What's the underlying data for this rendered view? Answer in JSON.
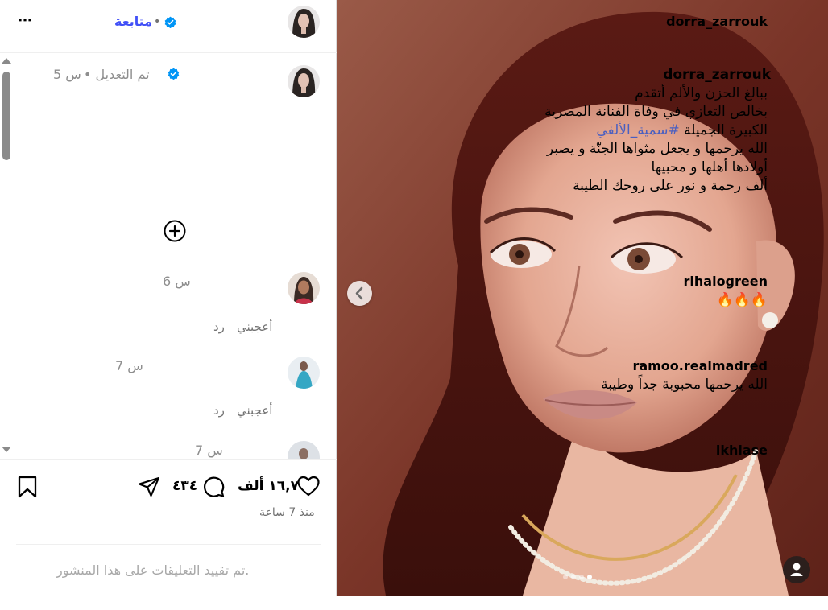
{
  "post": {
    "username": "dorra_zarrouk",
    "follow_label": "متابعة",
    "separator": "•",
    "more_label": "⋯"
  },
  "caption": {
    "username": "dorra_zarrouk",
    "edited_label": "• تم التعديل",
    "time": "5 س",
    "lines": [
      "ببالغ الحزن والألم أتقدم",
      "بخالص التعازي في وفاة الفنانة المصرية",
      "الكبيرة الجميلة",
      "الله يرحمها و يجعل مثواها الجنّة  و يصبر",
      "أولادها أهلها و محبيها",
      "ألف رحمة و نور على روحك الطيبة"
    ],
    "hashtag": "#سمية_الألفي"
  },
  "comments": [
    {
      "username": "rihalogreen",
      "time": "6 س",
      "text": "🔥🔥🔥",
      "like_label": "أعجبني",
      "reply_label": "رد"
    },
    {
      "username": "ramoo.realmadred",
      "time": "7 س",
      "text": "الله يرحمها محبوبة جداً وطيبة",
      "like_label": "أعجبني",
      "reply_label": "رد"
    },
    {
      "username": "ikhlase",
      "time": "7 س"
    }
  ],
  "actions": {
    "likes_count": "١٦,٧ ألف",
    "comments_count": "٤٣٤",
    "posted_ago": "منذ 7 ساعة"
  },
  "footer": {
    "comments_restricted": "تم تقييد التعليقات على هذا المنشور."
  },
  "carousel": {
    "slide_count": 4,
    "active_index": 4
  },
  "colors": {
    "link_blue": "#4150f7",
    "hashtag_blue": "#4a5fc1",
    "verified_blue": "#0095f6",
    "muted_text": "#737373"
  }
}
